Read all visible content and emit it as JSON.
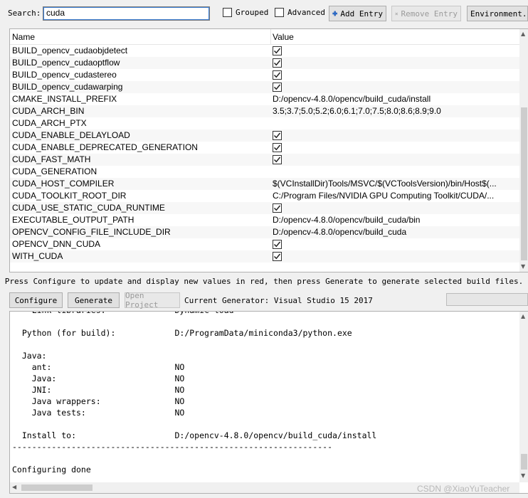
{
  "toolbar": {
    "search_label": "Search:",
    "search_value": "cuda",
    "grouped_label": "Grouped",
    "advanced_label": "Advanced",
    "add_entry_label": "Add Entry",
    "remove_entry_label": "Remove Entry",
    "environment_label": "Environment..."
  },
  "table": {
    "col_name": "Name",
    "col_value": "Value",
    "rows": [
      {
        "name": "BUILD_opencv_cudaobjdetect",
        "type": "bool",
        "value": true
      },
      {
        "name": "BUILD_opencv_cudaoptflow",
        "type": "bool",
        "value": true
      },
      {
        "name": "BUILD_opencv_cudastereo",
        "type": "bool",
        "value": true
      },
      {
        "name": "BUILD_opencv_cudawarping",
        "type": "bool",
        "value": true
      },
      {
        "name": "CMAKE_INSTALL_PREFIX",
        "type": "text",
        "value": "D:/opencv-4.8.0/opencv/build_cuda/install"
      },
      {
        "name": "CUDA_ARCH_BIN",
        "type": "text",
        "value": "3.5;3.7;5.0;5.2;6.0;6.1;7.0;7.5;8.0;8.6;8.9;9.0"
      },
      {
        "name": "CUDA_ARCH_PTX",
        "type": "text",
        "value": ""
      },
      {
        "name": "CUDA_ENABLE_DELAYLOAD",
        "type": "bool",
        "value": true
      },
      {
        "name": "CUDA_ENABLE_DEPRECATED_GENERATION",
        "type": "bool",
        "value": true
      },
      {
        "name": "CUDA_FAST_MATH",
        "type": "bool",
        "value": true
      },
      {
        "name": "CUDA_GENERATION",
        "type": "text",
        "value": ""
      },
      {
        "name": "CUDA_HOST_COMPILER",
        "type": "text",
        "value": "$(VCInstallDir)Tools/MSVC/$(VCToolsVersion)/bin/Host$(..."
      },
      {
        "name": "CUDA_TOOLKIT_ROOT_DIR",
        "type": "text",
        "value": "C:/Program Files/NVIDIA GPU Computing Toolkit/CUDA/..."
      },
      {
        "name": "CUDA_USE_STATIC_CUDA_RUNTIME",
        "type": "bool",
        "value": true
      },
      {
        "name": "EXECUTABLE_OUTPUT_PATH",
        "type": "text",
        "value": "D:/opencv-4.8.0/opencv/build_cuda/bin"
      },
      {
        "name": "OPENCV_CONFIG_FILE_INCLUDE_DIR",
        "type": "text",
        "value": "D:/opencv-4.8.0/opencv/build_cuda"
      },
      {
        "name": "OPENCV_DNN_CUDA",
        "type": "bool",
        "value": true
      },
      {
        "name": "WITH_CUDA",
        "type": "bool",
        "value": true
      }
    ]
  },
  "hint": "Press Configure to update and display new values in red, then press Generate to generate selected build files.",
  "actions": {
    "configure_label": "Configure",
    "generate_label": "Generate",
    "open_project_label": "Open Project",
    "generator_text": "Current Generator: Visual Studio 15 2017"
  },
  "log": {
    "lines": [
      "    Link libraries:              Dynamic load",
      "",
      "  Python (for build):            D:/ProgramData/miniconda3/python.exe",
      "",
      "  Java:",
      "    ant:                         NO",
      "    Java:                        NO",
      "    JNI:                         NO",
      "    Java wrappers:               NO",
      "    Java tests:                  NO",
      "",
      "  Install to:                    D:/opencv-4.8.0/opencv/build_cuda/install",
      "-----------------------------------------------------------------",
      "",
      "Configuring done"
    ]
  },
  "watermark": "CSDN @XiaoYuTeacher"
}
